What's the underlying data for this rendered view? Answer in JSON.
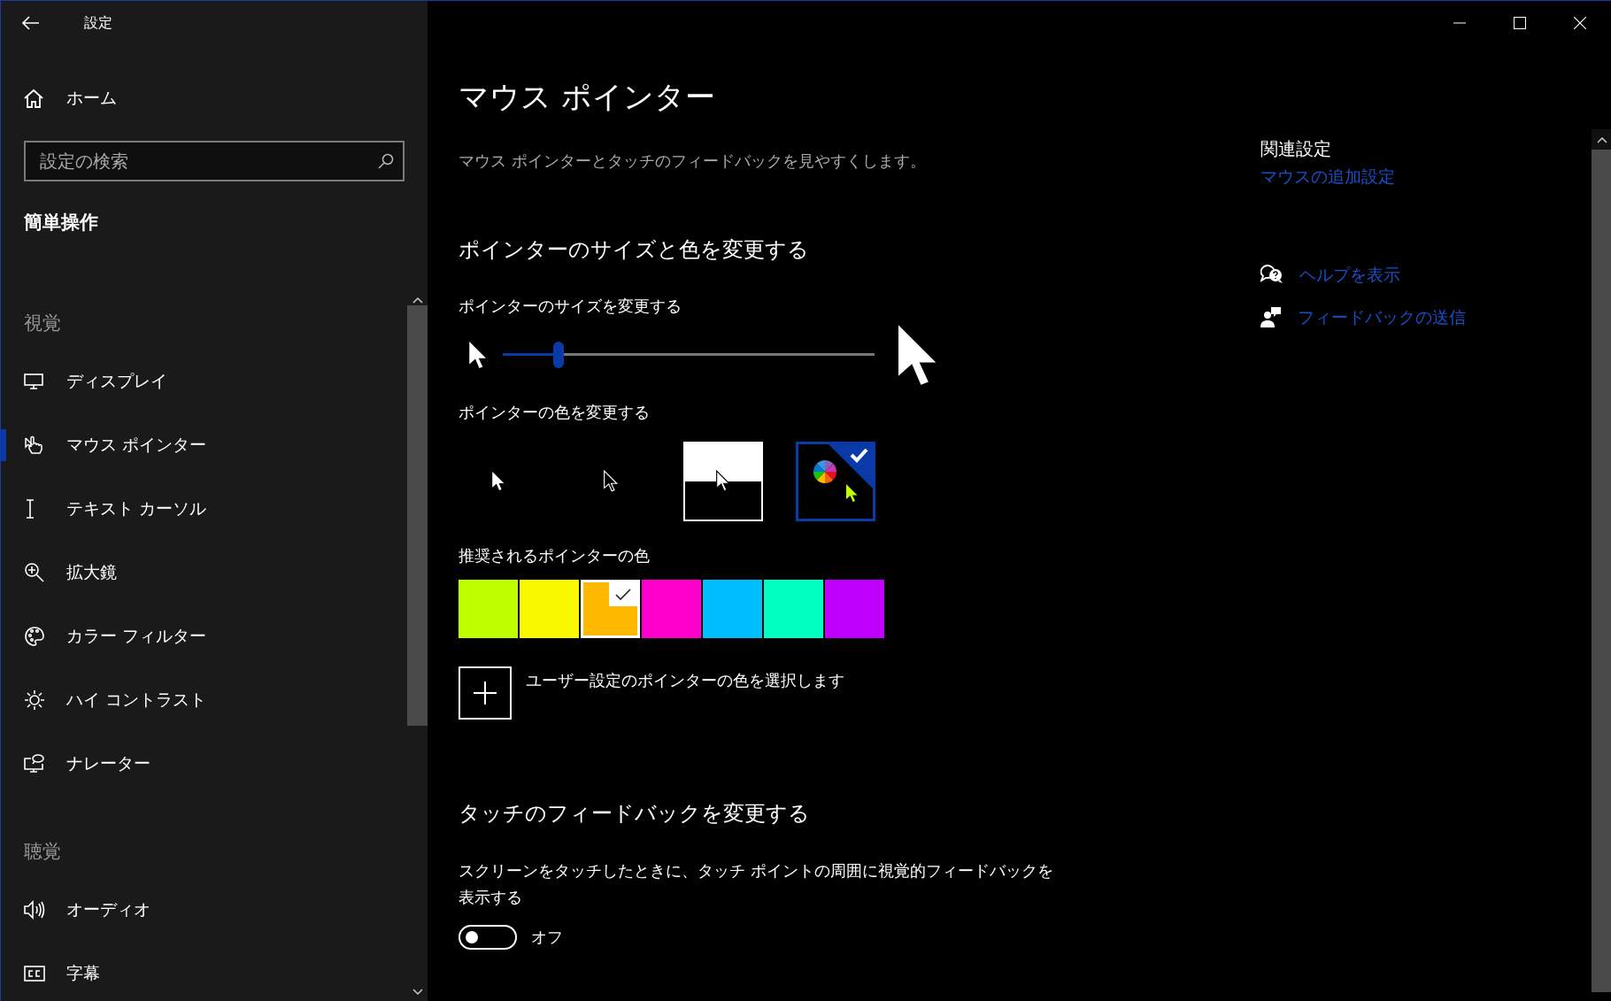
{
  "window": {
    "title": "設定"
  },
  "sidebar": {
    "home": "ホーム",
    "search": {
      "placeholder": "設定の検索"
    },
    "category": "簡単操作",
    "groups": [
      {
        "heading": "視覚",
        "items": [
          {
            "label": "ディスプレイ",
            "selected": false
          },
          {
            "label": "マウス ポインター",
            "selected": true
          },
          {
            "label": "テキスト カーソル",
            "selected": false
          },
          {
            "label": "拡大鏡",
            "selected": false
          },
          {
            "label": "カラー フィルター",
            "selected": false
          },
          {
            "label": "ハイ コントラスト",
            "selected": false
          },
          {
            "label": "ナレーター",
            "selected": false
          }
        ]
      },
      {
        "heading": "聴覚",
        "items": [
          {
            "label": "オーディオ",
            "selected": false
          },
          {
            "label": "字幕",
            "selected": false
          }
        ]
      }
    ]
  },
  "main": {
    "title": "マウス ポインター",
    "subtitle": "マウス ポインターとタッチのフィードバックを見やすくします。",
    "size_color_heading": "ポインターのサイズと色を変更する",
    "size": {
      "label": "ポインターのサイズを変更する",
      "level": 0.15
    },
    "color": {
      "label": "ポインターの色を変更する",
      "options": [
        {
          "kind": "white",
          "selected": false
        },
        {
          "kind": "black",
          "selected": false
        },
        {
          "kind": "inverted",
          "selected": false
        },
        {
          "kind": "custom",
          "selected": true
        }
      ]
    },
    "recommended": {
      "label": "推奨されるポインターの色",
      "swatches": [
        {
          "color": "#c0ff00",
          "selected": false
        },
        {
          "color": "#f8f800",
          "selected": false
        },
        {
          "color": "#ffb900",
          "selected": true
        },
        {
          "color": "#ff00cc",
          "selected": false
        },
        {
          "color": "#00bfff",
          "selected": false
        },
        {
          "color": "#00ffc0",
          "selected": false
        },
        {
          "color": "#c000ff",
          "selected": false
        }
      ]
    },
    "custom_color": {
      "label": "ユーザー設定のポインターの色を選択します"
    },
    "touch": {
      "heading": "タッチのフィードバックを変更する",
      "description": "スクリーンをタッチしたときに、タッチ ポイントの周囲に視覚的フィードバックを表示する",
      "toggle": {
        "on": false,
        "label": "オフ"
      }
    }
  },
  "related": {
    "heading": "関連設定",
    "links": [
      "マウスの追加設定"
    ],
    "help": [
      {
        "label": "ヘルプを表示"
      },
      {
        "label": "フィードバックの送信"
      }
    ]
  }
}
